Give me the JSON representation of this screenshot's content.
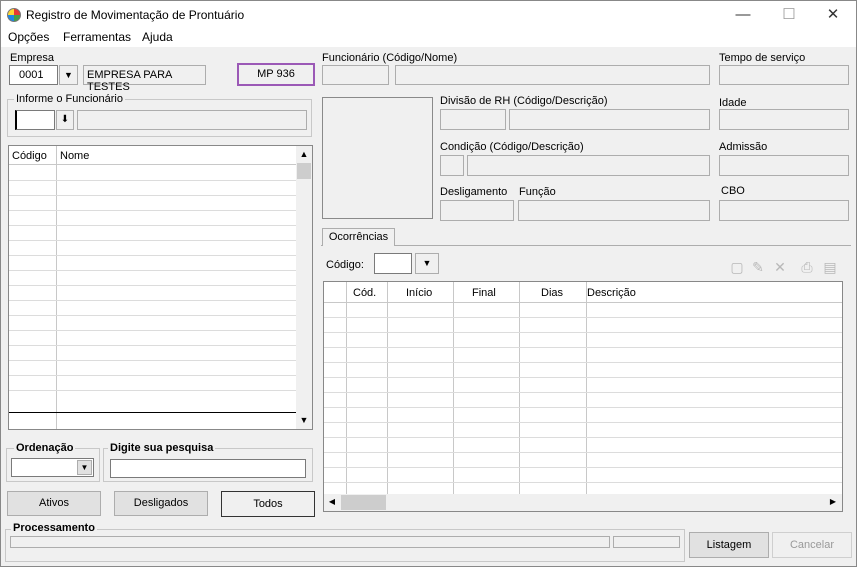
{
  "window": {
    "title": "Registro de Movimentação de Prontuário",
    "minimize": "—",
    "maximize": "☐",
    "close": "✕"
  },
  "menu": {
    "items": [
      "Opções",
      "Ferramentas",
      "Ajuda"
    ]
  },
  "empresa": {
    "label": "Empresa",
    "code": "0001",
    "name": "EMPRESA PARA TESTES",
    "badge": "MP 936"
  },
  "informe": {
    "label": "Informe o Funcionário"
  },
  "left_grid": {
    "headers": [
      "Código",
      "Nome"
    ]
  },
  "ordenacao": {
    "label": "Ordenação"
  },
  "pesquisa": {
    "label": "Digite sua pesquisa",
    "value": ""
  },
  "filter_buttons": {
    "ativos": "Ativos",
    "desligados": "Desligados",
    "todos": "Todos"
  },
  "processamento": {
    "label": "Processamento"
  },
  "funcionario": {
    "label": "Funcionário (Código/Nome)"
  },
  "tempo": {
    "label": "Tempo de serviço"
  },
  "divisao": {
    "label": "Divisão de RH (Código/Descrição)"
  },
  "idade": {
    "label": "Idade"
  },
  "condicao": {
    "label": "Condição (Código/Descrição)"
  },
  "admissao": {
    "label": "Admissão"
  },
  "desligamento": {
    "label": "Desligamento"
  },
  "funcao": {
    "label": "Função"
  },
  "cbo": {
    "label": "CBO"
  },
  "tabs": {
    "ocorrencias": "Ocorrências"
  },
  "codigo": {
    "label": "Código:"
  },
  "occ_grid": {
    "headers": [
      "Cód.",
      "Início",
      "Final",
      "Dias",
      "Descrição"
    ]
  },
  "bottom_buttons": {
    "listagem": "Listagem",
    "cancelar": "Cancelar"
  },
  "icons": {
    "new": "new-document-icon",
    "edit": "pencil-icon",
    "delete": "x-icon",
    "print": "printer-icon",
    "export": "export-icon"
  }
}
